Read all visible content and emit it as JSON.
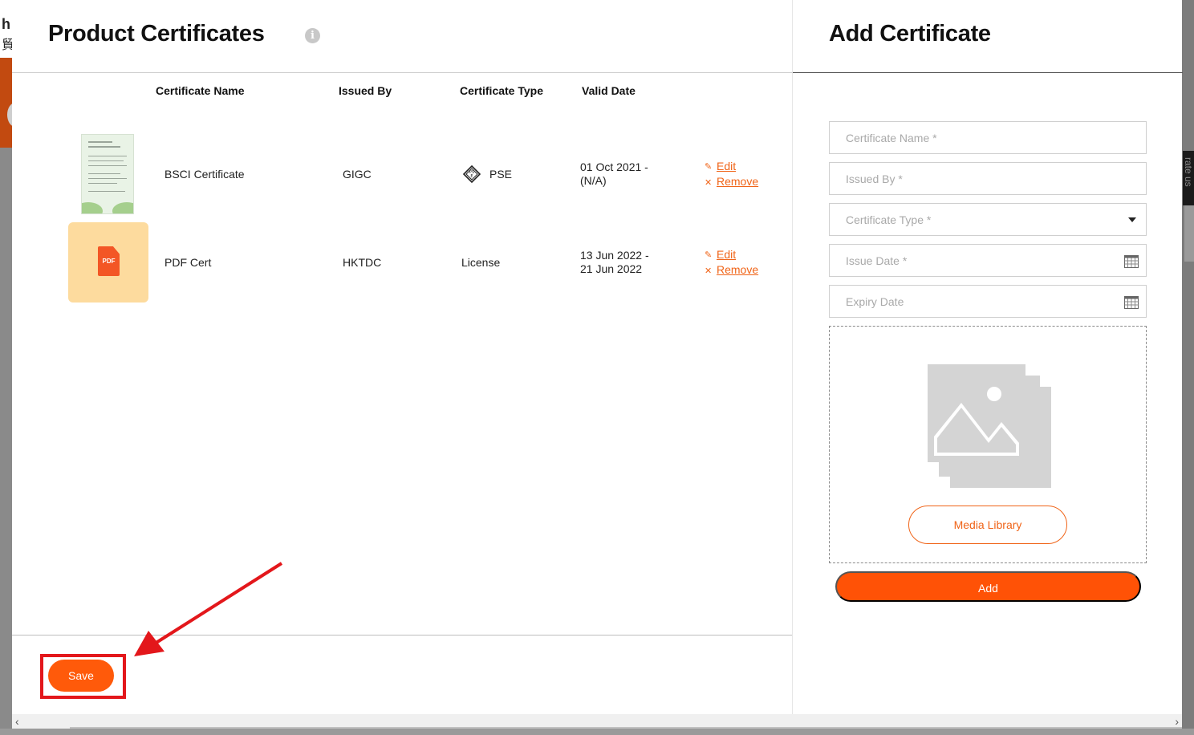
{
  "left": {
    "title": "Product Certificates",
    "info_icon_char": "i",
    "columns": [
      "Certificate Name",
      "Issued By",
      "Certificate Type",
      "Valid Date"
    ],
    "rows": [
      {
        "name": "BSCI Certificate",
        "issued_by": "GIGC",
        "type": "PSE",
        "type_icon": "pse-mark-icon",
        "valid_line1": "01 Oct 2021 -",
        "valid_line2": "(N/A)",
        "edit": "Edit",
        "remove": "Remove",
        "thumbnail": "certificate-image"
      },
      {
        "name": "PDF Cert",
        "issued_by": "HKTDC",
        "type": "License",
        "valid_line1": "13 Jun 2022 -",
        "valid_line2": "21 Jun 2022",
        "edit": "Edit",
        "remove": "Remove",
        "thumbnail": "pdf-file-icon",
        "pdf_label": "PDF"
      }
    ],
    "save_label": "Save"
  },
  "right": {
    "title": "Add Certificate",
    "fields": {
      "certificate_name": {
        "placeholder": "Certificate Name *"
      },
      "issued_by": {
        "placeholder": "Issued By *"
      },
      "certificate_type": {
        "placeholder": "Certificate Type *"
      },
      "issue_date": {
        "placeholder": "Issue Date *"
      },
      "expiry_date": {
        "placeholder": "Expiry Date"
      }
    },
    "media_library_label": "Media Library",
    "add_label": "Add"
  },
  "background": {
    "logo_char_1": "h",
    "logo_char_2": "貿",
    "side_tab_text": "rate us"
  },
  "colors": {
    "accent": "#ff5a0a",
    "link": "#f06418",
    "pdf_tile": "#fddb9e",
    "highlight": "#e3171b"
  },
  "icons": {
    "edit": "pencil-icon",
    "remove": "close-icon",
    "calendar": "calendar-icon",
    "dropdown": "caret-down-icon",
    "image_placeholder": "image-stack-icon",
    "info": "info-icon"
  }
}
